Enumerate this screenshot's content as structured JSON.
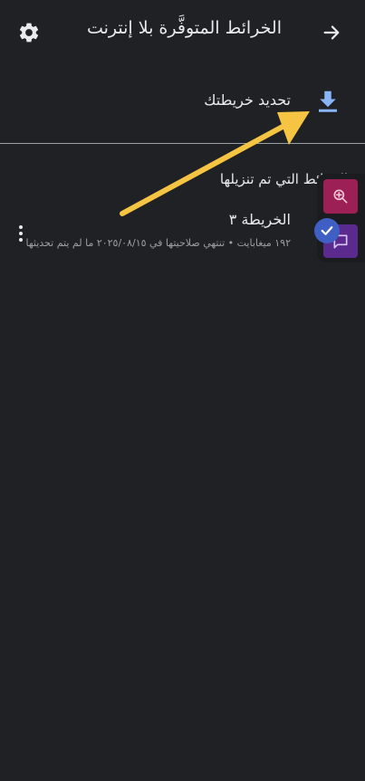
{
  "appbar": {
    "title": "الخرائط المتوفَّرة بلا إنترنت",
    "back_icon": "arrow-forward-icon",
    "settings_icon": "gear-icon"
  },
  "update": {
    "label": "تحديد خريطتك",
    "icon": "download-icon"
  },
  "downloaded": {
    "header": "الخرائط التي تم تنزيلها",
    "items": [
      {
        "name": "الخريطة ٣",
        "meta": "١٩٢ ميغابايت • تنتهي صلاحيتها في ٢٠٢٥/٠٨/١٥ ما لم يتم تحديثها"
      }
    ]
  },
  "colors": {
    "background": "#202124",
    "accent": "#8ab4f8",
    "annotation_arrow": "#f6c443",
    "zoom_button": "#9c1f55",
    "chat_button": "#5b2a8f"
  }
}
